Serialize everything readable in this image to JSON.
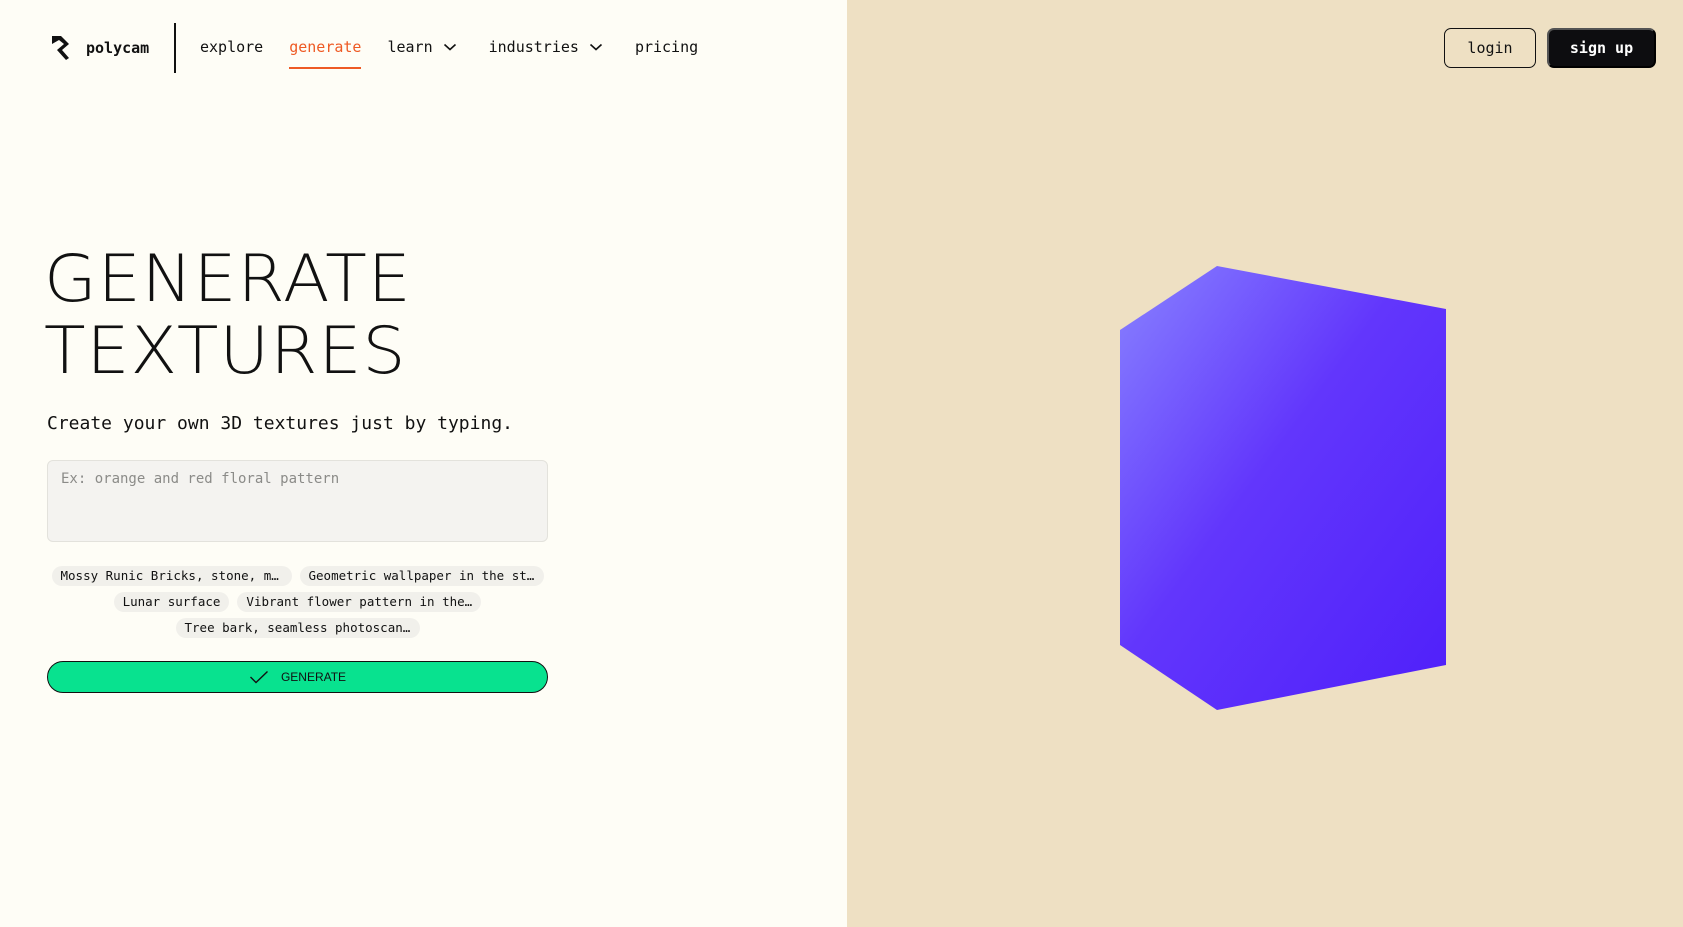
{
  "brand": {
    "name": "polycam",
    "logo_icon": "polycam-logo-icon"
  },
  "nav": {
    "items": [
      {
        "label": "explore",
        "active": false,
        "dropdown": false
      },
      {
        "label": "generate",
        "active": true,
        "dropdown": false
      },
      {
        "label": "learn",
        "active": false,
        "dropdown": true
      },
      {
        "label": "industries",
        "active": false,
        "dropdown": true
      },
      {
        "label": "pricing",
        "active": false,
        "dropdown": false
      }
    ]
  },
  "auth": {
    "login_label": "login",
    "signup_label": "sign up"
  },
  "hero": {
    "title_line1": "GENERATE",
    "title_line2": "TEXTURES",
    "subtitle": "Create your own 3D textures just by typing."
  },
  "prompt": {
    "value": "",
    "placeholder": "Ex: orange and red floral pattern"
  },
  "suggestions": [
    "Mossy Runic Bricks, stone, moss",
    "Geometric wallpaper in the style of art deco",
    "Lunar surface",
    "Vibrant flower pattern in the style of William Morris",
    "Tree bark, seamless photoscan texture"
  ],
  "generate_button": {
    "label": "GENERATE",
    "icon": "check-icon"
  },
  "preview": {
    "shape": "cube",
    "icon": "cube-preview"
  },
  "colors": {
    "page_bg": "#fefdf6",
    "preview_bg": "#eee0c3",
    "accent": "#ee5a24",
    "generate_green": "#08e28f",
    "cube_light": "#8882ff",
    "cube_dark": "#4f1ffa"
  }
}
